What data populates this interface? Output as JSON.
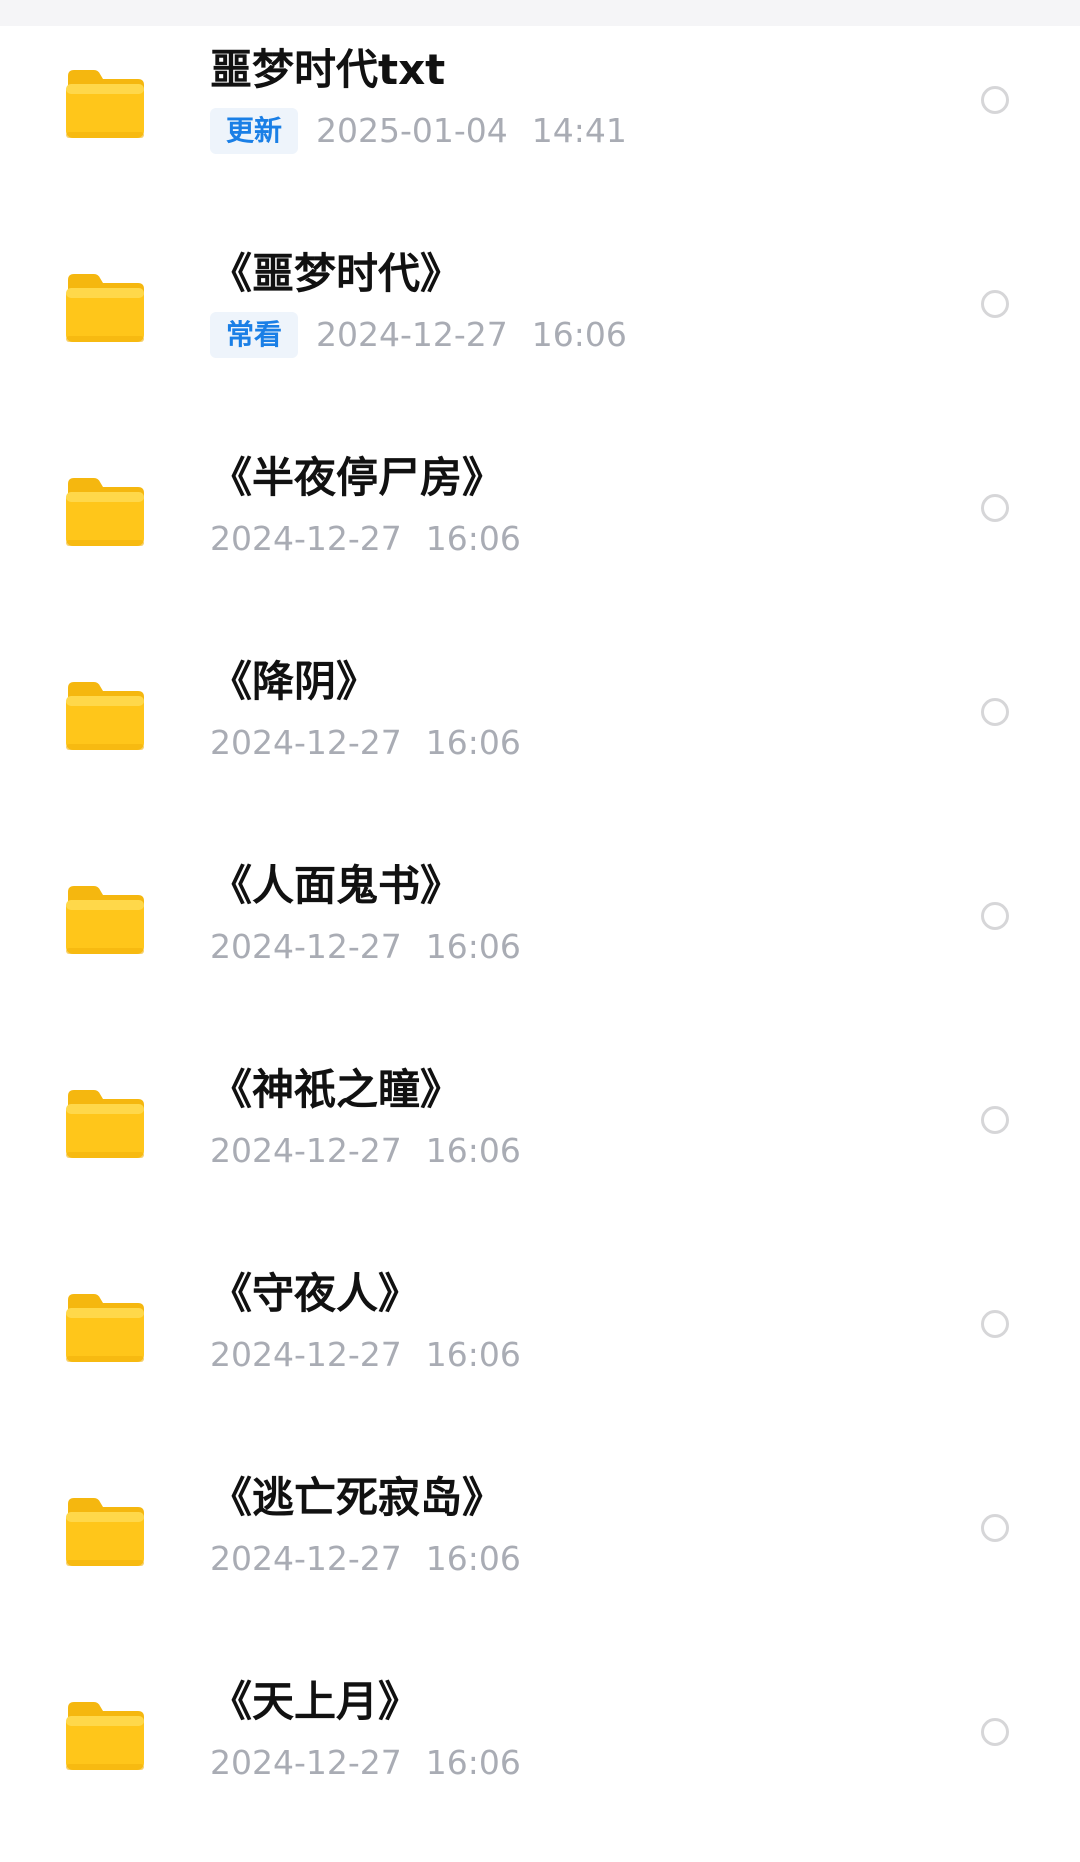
{
  "files": [
    {
      "name": "噩梦时代txt",
      "tag": "更新",
      "date": "2025-01-04",
      "time": "14:41"
    },
    {
      "name": "《噩梦时代》",
      "tag": "常看",
      "date": "2024-12-27",
      "time": "16:06"
    },
    {
      "name": "《半夜停尸房》",
      "tag": "",
      "date": "2024-12-27",
      "time": "16:06"
    },
    {
      "name": "《降阴》",
      "tag": "",
      "date": "2024-12-27",
      "time": "16:06"
    },
    {
      "name": "《人面鬼书》",
      "tag": "",
      "date": "2024-12-27",
      "time": "16:06"
    },
    {
      "name": "《神祇之瞳》",
      "tag": "",
      "date": "2024-12-27",
      "time": "16:06"
    },
    {
      "name": "《守夜人》",
      "tag": "",
      "date": "2024-12-27",
      "time": "16:06"
    },
    {
      "name": "《逃亡死寂岛》",
      "tag": "",
      "date": "2024-12-27",
      "time": "16:06"
    },
    {
      "name": "《天上月》",
      "tag": "",
      "date": "2024-12-27",
      "time": "16:06"
    }
  ],
  "icons": {
    "item_icon": "folder-icon",
    "select_icon": "radio-circle-icon"
  },
  "colors": {
    "folder_top": "#FFD84A",
    "folder_body": "#FFC61A",
    "tag_text": "#1A7FE6",
    "tag_bg": "#EEF4FB",
    "meta_text": "#A9ACB4",
    "title_text": "#111111",
    "radio_border": "#D6D6D8"
  }
}
